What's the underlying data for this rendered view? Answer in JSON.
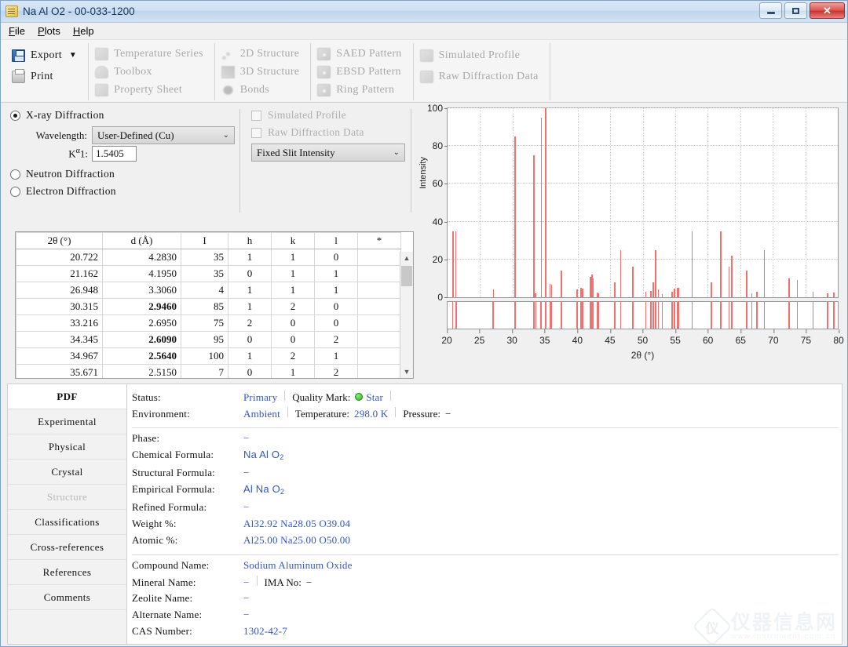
{
  "window": {
    "title": "Na Al O2 - 00-033-1200",
    "icon": "document-icon",
    "minimize_label": "",
    "maximize_label": "",
    "close_label": "✕"
  },
  "menubar": {
    "items": [
      {
        "label": "File",
        "accel": "F"
      },
      {
        "label": "Plots",
        "accel": "P"
      },
      {
        "label": "Help",
        "accel": "H"
      }
    ]
  },
  "toolbar": {
    "groups": [
      {
        "items": [
          {
            "label": "Export",
            "icon": "floppy-disk-icon",
            "disabled": false,
            "dropdown": "▼"
          },
          {
            "label": "Print",
            "icon": "printer-icon",
            "disabled": false
          }
        ]
      },
      {
        "items": [
          {
            "label": "Temperature Series",
            "icon": "temperature-series-icon",
            "disabled": true
          },
          {
            "label": "Toolbox",
            "icon": "toolbox-icon",
            "disabled": true
          },
          {
            "label": "Property Sheet",
            "icon": "property-sheet-icon",
            "disabled": true
          }
        ]
      },
      {
        "items": [
          {
            "label": "2D Structure",
            "icon": "2d-structure-icon",
            "disabled": true
          },
          {
            "label": "3D Structure",
            "icon": "3d-structure-icon",
            "disabled": true
          },
          {
            "label": "Bonds",
            "icon": "bonds-icon",
            "disabled": true
          }
        ]
      },
      {
        "items": [
          {
            "label": "SAED Pattern",
            "icon": "saed-pattern-icon",
            "disabled": true
          },
          {
            "label": "EBSD Pattern",
            "icon": "ebsd-pattern-icon",
            "disabled": true
          },
          {
            "label": "Ring Pattern",
            "icon": "ring-pattern-icon",
            "disabled": true
          }
        ]
      },
      {
        "items": [
          {
            "label": "Simulated Profile",
            "icon": "simulated-profile-icon",
            "disabled": true
          },
          {
            "label": "Raw Diffraction Data",
            "icon": "raw-diffraction-data-icon",
            "disabled": true
          }
        ]
      }
    ]
  },
  "settings": {
    "radiation": [
      {
        "label": "X-ray Diffraction",
        "selected": true
      },
      {
        "label": "Neutron Diffraction",
        "selected": false
      },
      {
        "label": "Electron Diffraction",
        "selected": false
      }
    ],
    "wavelength_label": "Wavelength:",
    "wavelength_source": "User-Defined (Cu)",
    "ka1_label": "Kα1:",
    "ka1_value": "1.5405",
    "checkboxes": [
      {
        "label": "Simulated Profile",
        "checked": false,
        "disabled": true
      },
      {
        "label": "Raw Diffraction Data",
        "checked": false,
        "disabled": true
      }
    ],
    "intensity_mode": "Fixed Slit Intensity"
  },
  "table": {
    "columns": [
      "2θ (°)",
      "d (Å)",
      "I",
      "h",
      "k",
      "l",
      "*"
    ],
    "rows": [
      {
        "two_theta": "20.722",
        "d": "4.2830",
        "I": "35",
        "h": "1",
        "k": "1",
        "l": "0",
        "star": "",
        "bold_d": false
      },
      {
        "two_theta": "21.162",
        "d": "4.1950",
        "I": "35",
        "h": "0",
        "k": "1",
        "l": "1",
        "star": "",
        "bold_d": false
      },
      {
        "two_theta": "26.948",
        "d": "3.3060",
        "I": "4",
        "h": "1",
        "k": "1",
        "l": "1",
        "star": "",
        "bold_d": false
      },
      {
        "two_theta": "30.315",
        "d": "2.9460",
        "I": "85",
        "h": "1",
        "k": "2",
        "l": "0",
        "star": "",
        "bold_d": true
      },
      {
        "two_theta": "33.216",
        "d": "2.6950",
        "I": "75",
        "h": "2",
        "k": "0",
        "l": "0",
        "star": "",
        "bold_d": false
      },
      {
        "two_theta": "34.345",
        "d": "2.6090",
        "I": "95",
        "h": "0",
        "k": "0",
        "l": "2",
        "star": "",
        "bold_d": true
      },
      {
        "two_theta": "34.967",
        "d": "2.5640",
        "I": "100",
        "h": "1",
        "k": "2",
        "l": "1",
        "star": "",
        "bold_d": true
      },
      {
        "two_theta": "35.671",
        "d": "2.5150",
        "I": "7",
        "h": "0",
        "k": "1",
        "l": "2",
        "star": "",
        "bold_d": false
      }
    ],
    "scrollbar": {
      "up": "▲",
      "down": "▼"
    }
  },
  "chart_data": {
    "type": "bar",
    "title": "",
    "xlabel": "2θ (°)",
    "ylabel": "Intensity",
    "xlim": [
      20,
      80
    ],
    "ylim": [
      0,
      100
    ],
    "grid": true,
    "xticks": [
      20,
      25,
      30,
      35,
      40,
      45,
      50,
      55,
      60,
      65,
      70,
      75,
      80
    ],
    "yticks": [
      0,
      20,
      40,
      60,
      80,
      100
    ],
    "series_color": "#f2706e",
    "x": [
      20.722,
      21.162,
      26.948,
      30.315,
      33.216,
      33.45,
      34.345,
      34.967,
      35.671,
      35.9,
      37.4,
      39.8,
      40.4,
      40.7,
      41.9,
      42.1,
      42.3,
      42.9,
      43.1,
      45.6,
      46.5,
      48.4,
      50.4,
      51.2,
      51.5,
      51.9,
      52.3,
      52.9,
      54.4,
      54.8,
      55.2,
      55.4,
      57.5,
      60.5,
      61.9,
      63.2,
      63.6,
      65.9,
      66.7,
      67.5,
      68.6,
      72.4,
      73.7,
      76.1,
      78.3,
      79.3
    ],
    "values": [
      35,
      35,
      4,
      85,
      75,
      2,
      95,
      100,
      7,
      6.5,
      14,
      4,
      5,
      4.5,
      11,
      12,
      10,
      2.5,
      2,
      8,
      25,
      16,
      3,
      3.5,
      8,
      25,
      4,
      1.5,
      3,
      4.5,
      5,
      5,
      35,
      8,
      35,
      16,
      22,
      14,
      2,
      3,
      25,
      10,
      9,
      3,
      2,
      2.5
    ],
    "reflection_band": [
      20.7,
      21.2,
      26.9,
      30.3,
      33.2,
      33.5,
      34.3,
      35.0,
      35.7,
      35.9,
      37.4,
      39.8,
      40.4,
      40.7,
      41.9,
      42.1,
      42.3,
      42.9,
      43.1,
      45.6,
      46.5,
      48.4,
      50.4,
      51.2,
      51.5,
      51.9,
      52.3,
      52.9,
      54.4,
      54.8,
      55.2,
      55.4,
      57.5,
      60.5,
      61.9,
      63.2,
      63.6,
      65.9,
      66.7,
      67.5,
      68.6,
      72.4,
      73.7,
      76.1,
      78.3,
      79.3
    ]
  },
  "sidebar": {
    "items": [
      {
        "label": "PDF",
        "active": true,
        "disabled": false
      },
      {
        "label": "Experimental",
        "active": false,
        "disabled": false
      },
      {
        "label": "Physical",
        "active": false,
        "disabled": false
      },
      {
        "label": "Crystal",
        "active": false,
        "disabled": false
      },
      {
        "label": "Structure",
        "active": false,
        "disabled": true
      },
      {
        "label": "Classifications",
        "active": false,
        "disabled": false
      },
      {
        "label": "Cross-references",
        "active": false,
        "disabled": false
      },
      {
        "label": "References",
        "active": false,
        "disabled": false
      },
      {
        "label": "Comments",
        "active": false,
        "disabled": false
      }
    ]
  },
  "details": {
    "status_label": "Status:",
    "status_value": "Primary",
    "quality_label": "Quality Mark:",
    "quality_value": "Star",
    "environment_label": "Environment:",
    "environment_value": "Ambient",
    "temperature_label": "Temperature:",
    "temperature_value": "298.0 K",
    "pressure_label": "Pressure:",
    "pressure_value": "−",
    "phase_label": "Phase:",
    "phase_value": "−",
    "chemical_formula_label": "Chemical Formula:",
    "chemical_formula_value": "Na Al O",
    "chemical_formula_sub": "2",
    "structural_formula_label": "Structural Formula:",
    "structural_formula_value": "−",
    "empirical_formula_label": "Empirical Formula:",
    "empirical_formula_value": "Al Na O",
    "empirical_formula_sub": "2",
    "refined_formula_label": "Refined Formula:",
    "refined_formula_value": "−",
    "weight_label": "Weight %:",
    "weight_value": "Al32.92 Na28.05 O39.04",
    "atomic_label": "Atomic %:",
    "atomic_value": "Al25.00 Na25.00 O50.00",
    "compound_name_label": "Compound Name:",
    "compound_name_value": "Sodium Aluminum Oxide",
    "mineral_name_label": "Mineral Name:",
    "mineral_name_value": "−",
    "ima_label": "IMA No:",
    "ima_value": "−",
    "zeolite_name_label": "Zeolite Name:",
    "zeolite_name_value": "−",
    "alternate_name_label": "Alternate Name:",
    "alternate_name_value": "−",
    "cas_label": "CAS Number:",
    "cas_value": "1302-42-7"
  },
  "watermark": {
    "cn": "仪器信息网",
    "en": "www.instrument.com.cn",
    "badge": "仪"
  }
}
